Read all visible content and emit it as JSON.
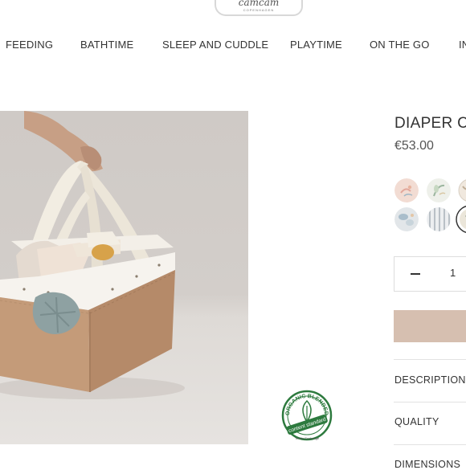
{
  "logo": {
    "brand": "camcam",
    "sub": "COPENHAGEN"
  },
  "nav": {
    "items": [
      {
        "label": "FEEDING"
      },
      {
        "label": "BATHTIME"
      },
      {
        "label": "SLEEP AND CUDDLE"
      },
      {
        "label": "PLAYTIME"
      },
      {
        "label": "ON THE GO"
      },
      {
        "label": "IN"
      }
    ]
  },
  "product": {
    "title": "DIAPER CA",
    "price": "€53.00",
    "quantity": "1",
    "swatches": [
      {
        "name": "swatch-pink-floral",
        "color": "#f1d9d0"
      },
      {
        "name": "swatch-green-leaves",
        "color": "#e8ece4"
      },
      {
        "name": "swatch-beige-partial",
        "color": "#efe6dc"
      },
      {
        "name": "swatch-blue-pattern",
        "color": "#dde2e6"
      },
      {
        "name": "swatch-grey-stripes",
        "color": "#e4e6e8"
      },
      {
        "name": "swatch-selected-cream",
        "color": "#e9e4d8"
      }
    ],
    "accent_color": "#d6bfb0"
  },
  "accordion": {
    "description": "DESCRIPTION",
    "quality": "QUALITY",
    "dimensions": "DIMENSIONS"
  },
  "badge": {
    "top_text": "ORGANIC BLENDED",
    "bottom_text": "content standard",
    "sub_text": "Textile Exchange"
  }
}
